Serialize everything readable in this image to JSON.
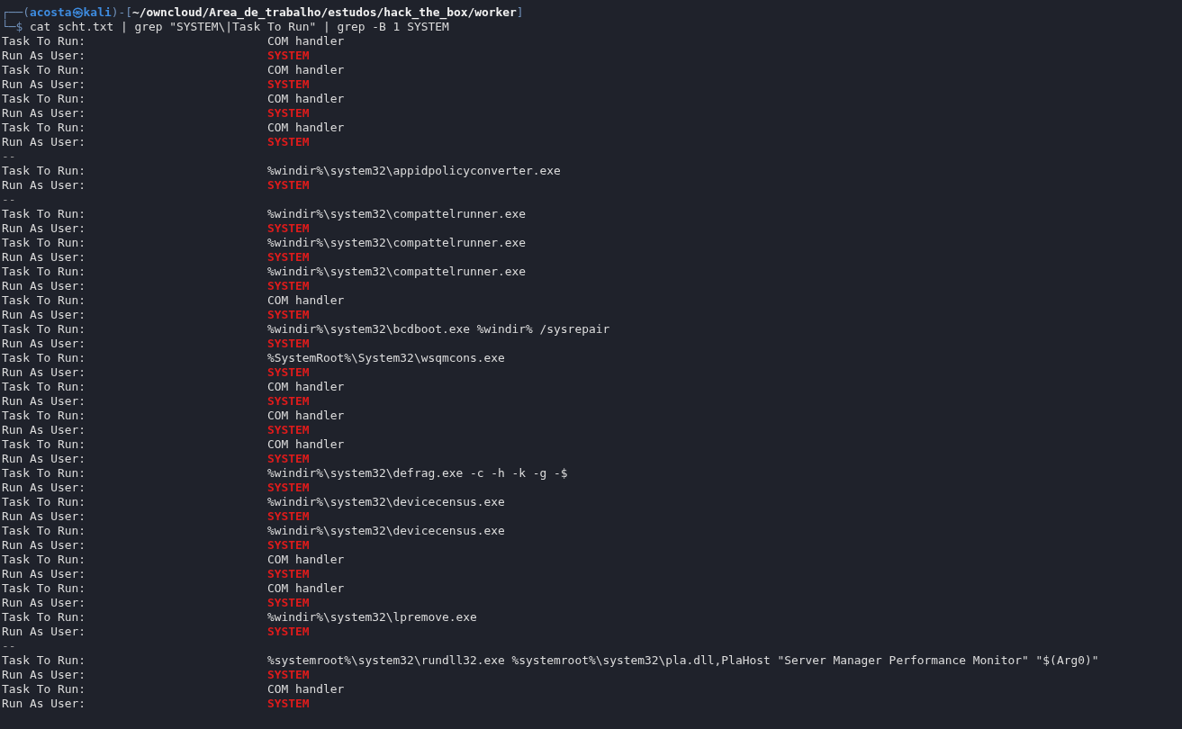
{
  "prompt": {
    "line1": [
      {
        "kind": "frame",
        "text": "┌──("
      },
      {
        "kind": "user",
        "text": "acosta㉿kali"
      },
      {
        "kind": "frame",
        "text": ")-["
      },
      {
        "kind": "path",
        "text": "~/owncloud/Area_de_trabalho/estudos/hack_the_box/worker"
      },
      {
        "kind": "frame",
        "text": "]"
      }
    ],
    "symbol": "└─$",
    "command": "cat scht.txt | grep \"SYSTEM\\|Task To Run\" | grep -B 1 SYSTEM"
  },
  "output": [
    {
      "kind": "task",
      "label": "Task To Run:",
      "value": "COM handler"
    },
    {
      "kind": "user",
      "label": "Run As User:",
      "value": "SYSTEM"
    },
    {
      "kind": "task",
      "label": "Task To Run:",
      "value": "COM handler"
    },
    {
      "kind": "user",
      "label": "Run As User:",
      "value": "SYSTEM"
    },
    {
      "kind": "task",
      "label": "Task To Run:",
      "value": "COM handler"
    },
    {
      "kind": "user",
      "label": "Run As User:",
      "value": "SYSTEM"
    },
    {
      "kind": "task",
      "label": "Task To Run:",
      "value": "COM handler"
    },
    {
      "kind": "user",
      "label": "Run As User:",
      "value": "SYSTEM"
    },
    {
      "kind": "separator",
      "label": "--"
    },
    {
      "kind": "task",
      "label": "Task To Run:",
      "value": "%windir%\\system32\\appidpolicyconverter.exe"
    },
    {
      "kind": "user",
      "label": "Run As User:",
      "value": "SYSTEM"
    },
    {
      "kind": "separator",
      "label": "--"
    },
    {
      "kind": "task",
      "label": "Task To Run:",
      "value": "%windir%\\system32\\compattelrunner.exe"
    },
    {
      "kind": "user",
      "label": "Run As User:",
      "value": "SYSTEM"
    },
    {
      "kind": "task",
      "label": "Task To Run:",
      "value": "%windir%\\system32\\compattelrunner.exe"
    },
    {
      "kind": "user",
      "label": "Run As User:",
      "value": "SYSTEM"
    },
    {
      "kind": "task",
      "label": "Task To Run:",
      "value": "%windir%\\system32\\compattelrunner.exe"
    },
    {
      "kind": "user",
      "label": "Run As User:",
      "value": "SYSTEM"
    },
    {
      "kind": "task",
      "label": "Task To Run:",
      "value": "COM handler"
    },
    {
      "kind": "user",
      "label": "Run As User:",
      "value": "SYSTEM"
    },
    {
      "kind": "task",
      "label": "Task To Run:",
      "value": "%windir%\\system32\\bcdboot.exe %windir% /sysrepair"
    },
    {
      "kind": "user",
      "label": "Run As User:",
      "value": "SYSTEM"
    },
    {
      "kind": "task",
      "label": "Task To Run:",
      "value": "%SystemRoot%\\System32\\wsqmcons.exe"
    },
    {
      "kind": "user",
      "label": "Run As User:",
      "value": "SYSTEM"
    },
    {
      "kind": "task",
      "label": "Task To Run:",
      "value": "COM handler"
    },
    {
      "kind": "user",
      "label": "Run As User:",
      "value": "SYSTEM"
    },
    {
      "kind": "task",
      "label": "Task To Run:",
      "value": "COM handler"
    },
    {
      "kind": "user",
      "label": "Run As User:",
      "value": "SYSTEM"
    },
    {
      "kind": "task",
      "label": "Task To Run:",
      "value": "COM handler"
    },
    {
      "kind": "user",
      "label": "Run As User:",
      "value": "SYSTEM"
    },
    {
      "kind": "task",
      "label": "Task To Run:",
      "value": "%windir%\\system32\\defrag.exe -c -h -k -g -$"
    },
    {
      "kind": "user",
      "label": "Run As User:",
      "value": "SYSTEM"
    },
    {
      "kind": "task",
      "label": "Task To Run:",
      "value": "%windir%\\system32\\devicecensus.exe"
    },
    {
      "kind": "user",
      "label": "Run As User:",
      "value": "SYSTEM"
    },
    {
      "kind": "task",
      "label": "Task To Run:",
      "value": "%windir%\\system32\\devicecensus.exe"
    },
    {
      "kind": "user",
      "label": "Run As User:",
      "value": "SYSTEM"
    },
    {
      "kind": "task",
      "label": "Task To Run:",
      "value": "COM handler"
    },
    {
      "kind": "user",
      "label": "Run As User:",
      "value": "SYSTEM"
    },
    {
      "kind": "task",
      "label": "Task To Run:",
      "value": "COM handler"
    },
    {
      "kind": "user",
      "label": "Run As User:",
      "value": "SYSTEM"
    },
    {
      "kind": "task",
      "label": "Task To Run:",
      "value": "%windir%\\system32\\lpremove.exe"
    },
    {
      "kind": "user",
      "label": "Run As User:",
      "value": "SYSTEM"
    },
    {
      "kind": "separator",
      "label": "--"
    },
    {
      "kind": "task",
      "label": "Task To Run:",
      "value": "%systemroot%\\system32\\rundll32.exe %systemroot%\\system32\\pla.dll,PlaHost \"Server Manager Performance Monitor\" \"$(Arg0)\""
    },
    {
      "kind": "user",
      "label": "Run As User:",
      "value": "SYSTEM"
    },
    {
      "kind": "task",
      "label": "Task To Run:",
      "value": "COM handler"
    },
    {
      "kind": "user",
      "label": "Run As User:",
      "value": "SYSTEM"
    }
  ]
}
